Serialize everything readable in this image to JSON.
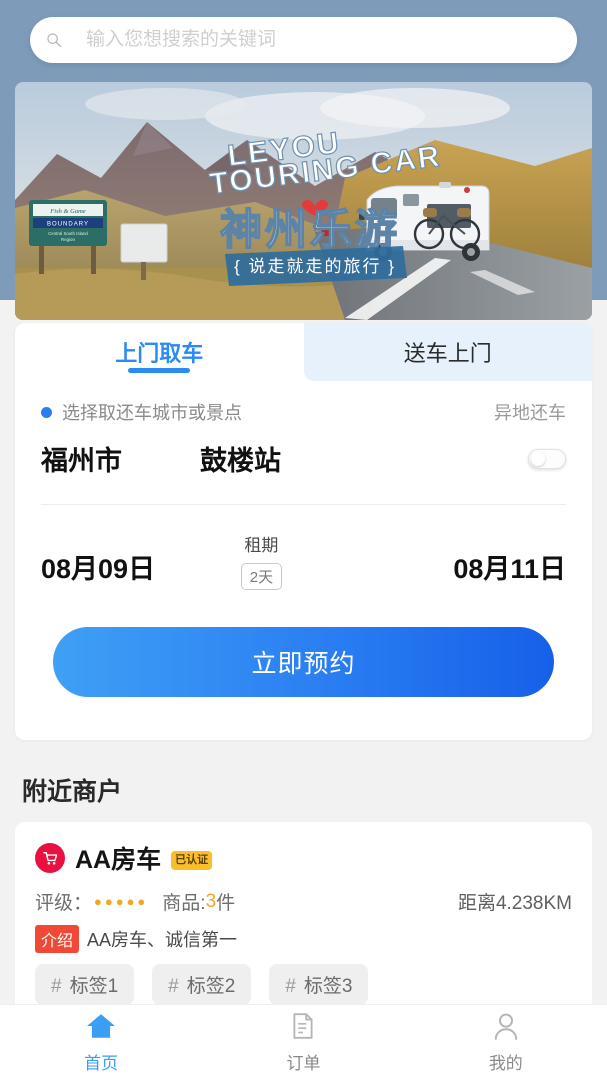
{
  "search": {
    "placeholder": "输入您想搜索的关键词",
    "value": "",
    "icon": "search-icon"
  },
  "banner": {
    "title_en_line1": "LEYOU",
    "title_en_line2": "TOURING CAR",
    "title_cn": "神州乐游",
    "ribbon": "{ 说走就走的旅行 }",
    "sign_line1": "Fish & Game",
    "sign_line2": "BOUNDARY",
    "sign_line3": "Central South Island Region"
  },
  "booking": {
    "tabs": [
      {
        "label": "上门取车",
        "active": true
      },
      {
        "label": "送车上门",
        "active": false
      }
    ],
    "hint": "选择取还车城市或景点",
    "remote_return_label": "异地还车",
    "remote_return_on": false,
    "city": "福州市",
    "station": "鼓楼站",
    "start_date": "08月09日",
    "end_date": "08月11日",
    "rent_label": "租期",
    "rent_days": "2天",
    "cta_label": "立即预约"
  },
  "nearby": {
    "section_title": "附近商户",
    "merchants": [
      {
        "name": "AA房车",
        "verified_badge": "已认证",
        "rating_label": "评级：",
        "stars": "●●●●●",
        "goods_label": "商品:",
        "goods_count": "3",
        "goods_unit": "件",
        "distance": "距离4.238KM",
        "intro_badge": "介绍",
        "description": "AA房车、诚信第一",
        "tags": [
          "标签1",
          "标签2",
          "标签3"
        ],
        "hash": "#"
      }
    ]
  },
  "bottom_nav": {
    "items": [
      {
        "label": "首页",
        "icon": "home-icon",
        "active": true
      },
      {
        "label": "订单",
        "icon": "document-icon",
        "active": false
      },
      {
        "label": "我的",
        "icon": "person-icon",
        "active": false
      }
    ]
  },
  "colors": {
    "accent_blue": "#2a8bf2",
    "top_band": "#7e9cba",
    "badge_orange": "#fbbe2b",
    "badge_red": "#f04a36",
    "shop_red": "#e8113f",
    "star_orange": "#f5a623"
  }
}
